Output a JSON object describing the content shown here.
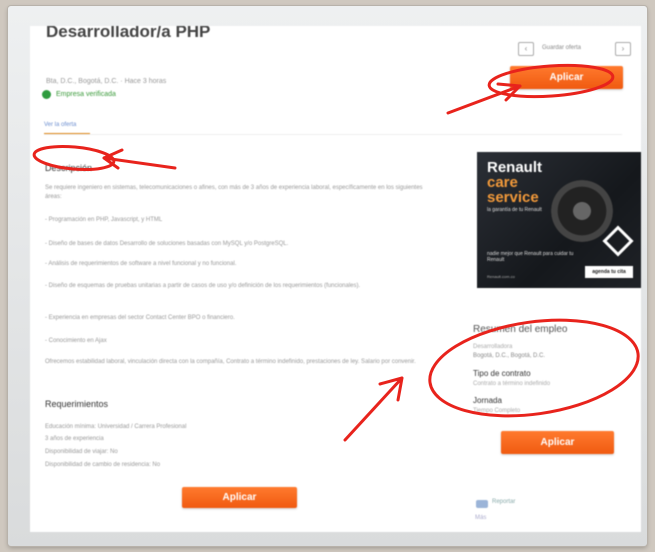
{
  "job": {
    "title": "Desarrollador/a PHP",
    "location": "Bta, D.C., Bogotá, D.C. · Hace 3 horas",
    "verified": "Empresa verificada",
    "tab": "Ver la oferta"
  },
  "toolbar": {
    "save_link": "Guardar oferta"
  },
  "buttons": {
    "apply": "Aplicar"
  },
  "description": {
    "heading": "Descripción",
    "paragraphs": [
      "Se requiere ingeniero en sistemas, telecomunicaciones o afines, con más de 3 años de experiencia laboral, específicamente en los siguientes áreas:",
      "- Programación en PHP, Javascript, y HTML",
      "- Diseño de bases de datos Desarrollo de soluciones basadas con MySQL y/o PostgreSQL.",
      "- Análisis de requerimientos de software a nivel funcional y no funcional.",
      "- Diseño de esquemas de pruebas unitarias a partir de casos de uso y/o definición de los requerimientos (funcionales).",
      "- Experiencia en empresas del sector Contact Center BPO o financiero.",
      "- Conocimiento en Ajax",
      "Ofrecemos estabilidad laboral, vinculación directa con la compañía, Contrato a término indefinido, prestaciones de ley. Salario por convenir."
    ]
  },
  "requirements": {
    "heading": "Requerimientos",
    "items": [
      "Educación mínima: Universidad / Carrera Profesional",
      "3 años de experiencia",
      "Disponibilidad de viajar: No",
      "Disponibilidad de cambio de residencia: No"
    ]
  },
  "ad": {
    "line1": "Renault",
    "line2": "care",
    "line3": "service",
    "tagline": "la garantía de tu Renault",
    "subtext": "nadie mejor que Renault para cuidar tu Renault",
    "cta": "agenda tu cita",
    "footer": "Renault.com.co"
  },
  "summary": {
    "title": "Resumen del empleo",
    "location_label": "Desarrolladora",
    "location_value": "Bogotá, D.C., Bogotá, D.C.",
    "contract_heading": "Tipo de contrato",
    "contract_value": "Contrato a término indefinido",
    "schedule_heading": "Jornada",
    "schedule_value": "Tiempo Completo"
  },
  "footer_links": {
    "report": "Reportar",
    "more": "Más"
  },
  "colors": {
    "accent": "#f26522",
    "annotation": "#e8231c",
    "verified": "#2e9c3e"
  }
}
